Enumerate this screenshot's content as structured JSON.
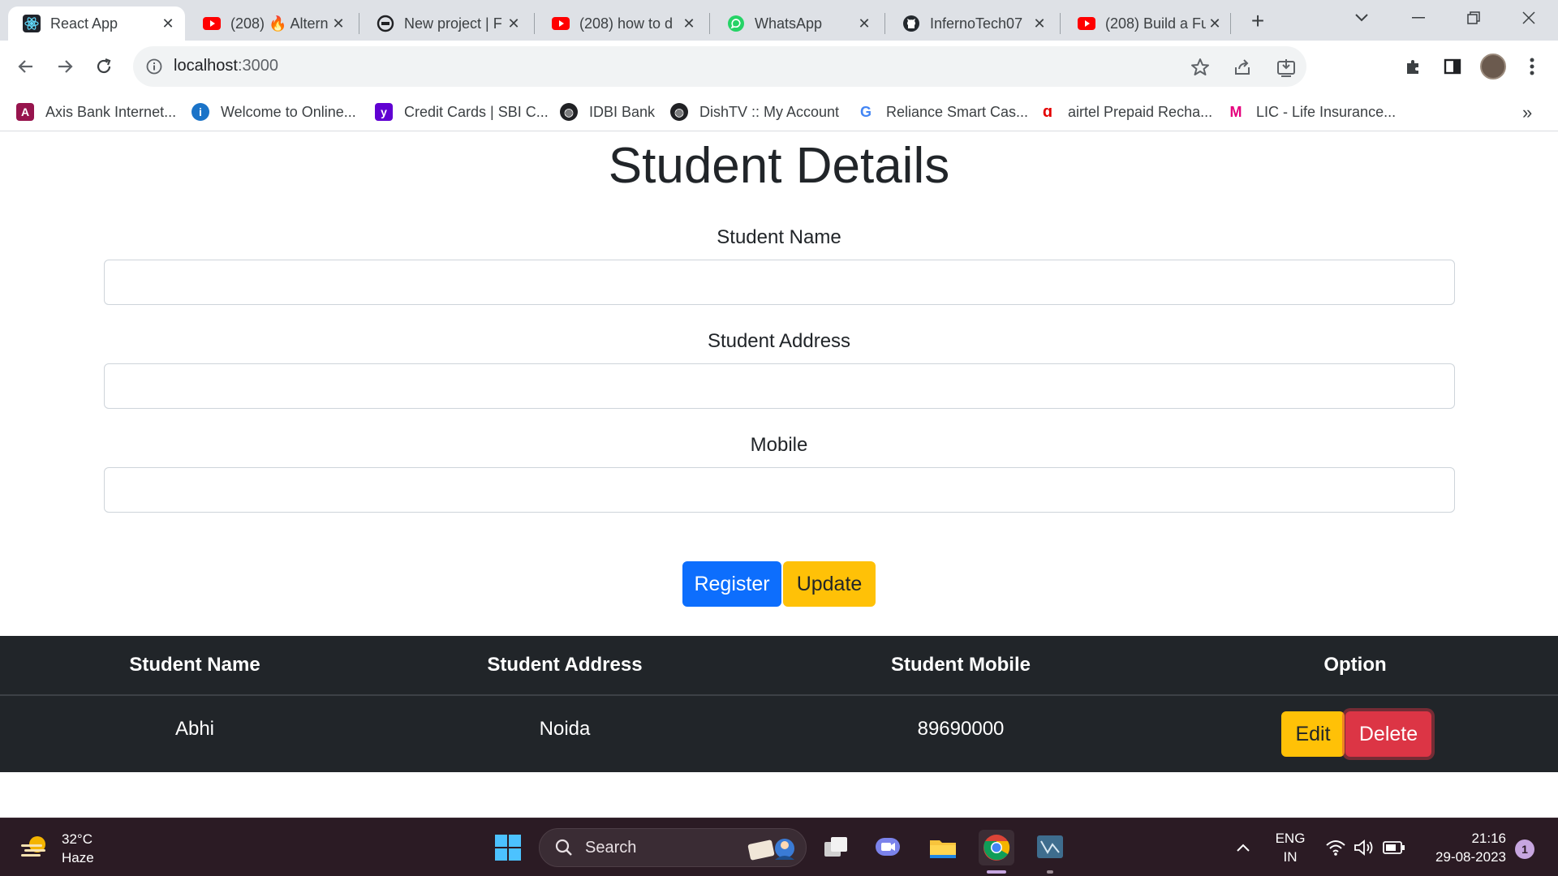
{
  "browser": {
    "tabs": [
      {
        "title": "React App",
        "active": true,
        "icon": "react-icon"
      },
      {
        "title": "(208) 🔥 Altern",
        "active": false,
        "icon": "youtube-icon"
      },
      {
        "title": "New project | F",
        "active": false,
        "icon": "figma-like-icon"
      },
      {
        "title": "(208) how to d",
        "active": false,
        "icon": "youtube-icon"
      },
      {
        "title": "WhatsApp",
        "active": false,
        "icon": "whatsapp-icon"
      },
      {
        "title": "InfernoTech07",
        "active": false,
        "icon": "github-icon"
      },
      {
        "title": "(208) Build a Fu",
        "active": false,
        "icon": "youtube-icon"
      }
    ],
    "address": {
      "host": "localhost",
      "port": ":3000"
    },
    "bookmarks": [
      {
        "label": "Axis Bank Internet...",
        "color": "#97144d",
        "glyph": "A"
      },
      {
        "label": "Welcome to Online...",
        "color": "#1a73c8",
        "glyph": "i"
      },
      {
        "label": "Credit Cards | SBI C...",
        "color": "#6001d2",
        "glyph": "y"
      },
      {
        "label": "IDBI Bank",
        "color": "#202124",
        "glyph": "●"
      },
      {
        "label": "DishTV :: My Account",
        "color": "#202124",
        "glyph": "●"
      },
      {
        "label": "Reliance Smart Cas...",
        "color": "#ffffff",
        "glyph": "G"
      },
      {
        "label": "airtel Prepaid Recha...",
        "color": "#e40000",
        "glyph": "a"
      },
      {
        "label": "LIC - Life Insurance...",
        "color": "#ffffff",
        "glyph": "M"
      }
    ]
  },
  "page": {
    "title": "Student Details",
    "form": {
      "name_label": "Student Name",
      "name_value": "",
      "address_label": "Student Address",
      "address_value": "",
      "mobile_label": "Mobile",
      "mobile_value": ""
    },
    "buttons": {
      "register": "Register",
      "update": "Update"
    },
    "table": {
      "headers": [
        "Student Name",
        "Student Address",
        "Student Mobile",
        "Option"
      ],
      "rows": [
        {
          "name": "Abhi",
          "address": "Noida",
          "mobile": "89690000",
          "edit": "Edit",
          "delete": "Delete"
        }
      ]
    }
  },
  "taskbar": {
    "weather": {
      "temp": "32°C",
      "condition": "Haze"
    },
    "search_label": "Search",
    "lang": {
      "line1": "ENG",
      "line2": "IN"
    },
    "time": "21:16",
    "date": "29-08-2023",
    "notifications": "1"
  },
  "colors": {
    "primary": "#0d6efd",
    "warning": "#ffc107",
    "danger": "#dc3545",
    "table_dark": "#212529"
  }
}
